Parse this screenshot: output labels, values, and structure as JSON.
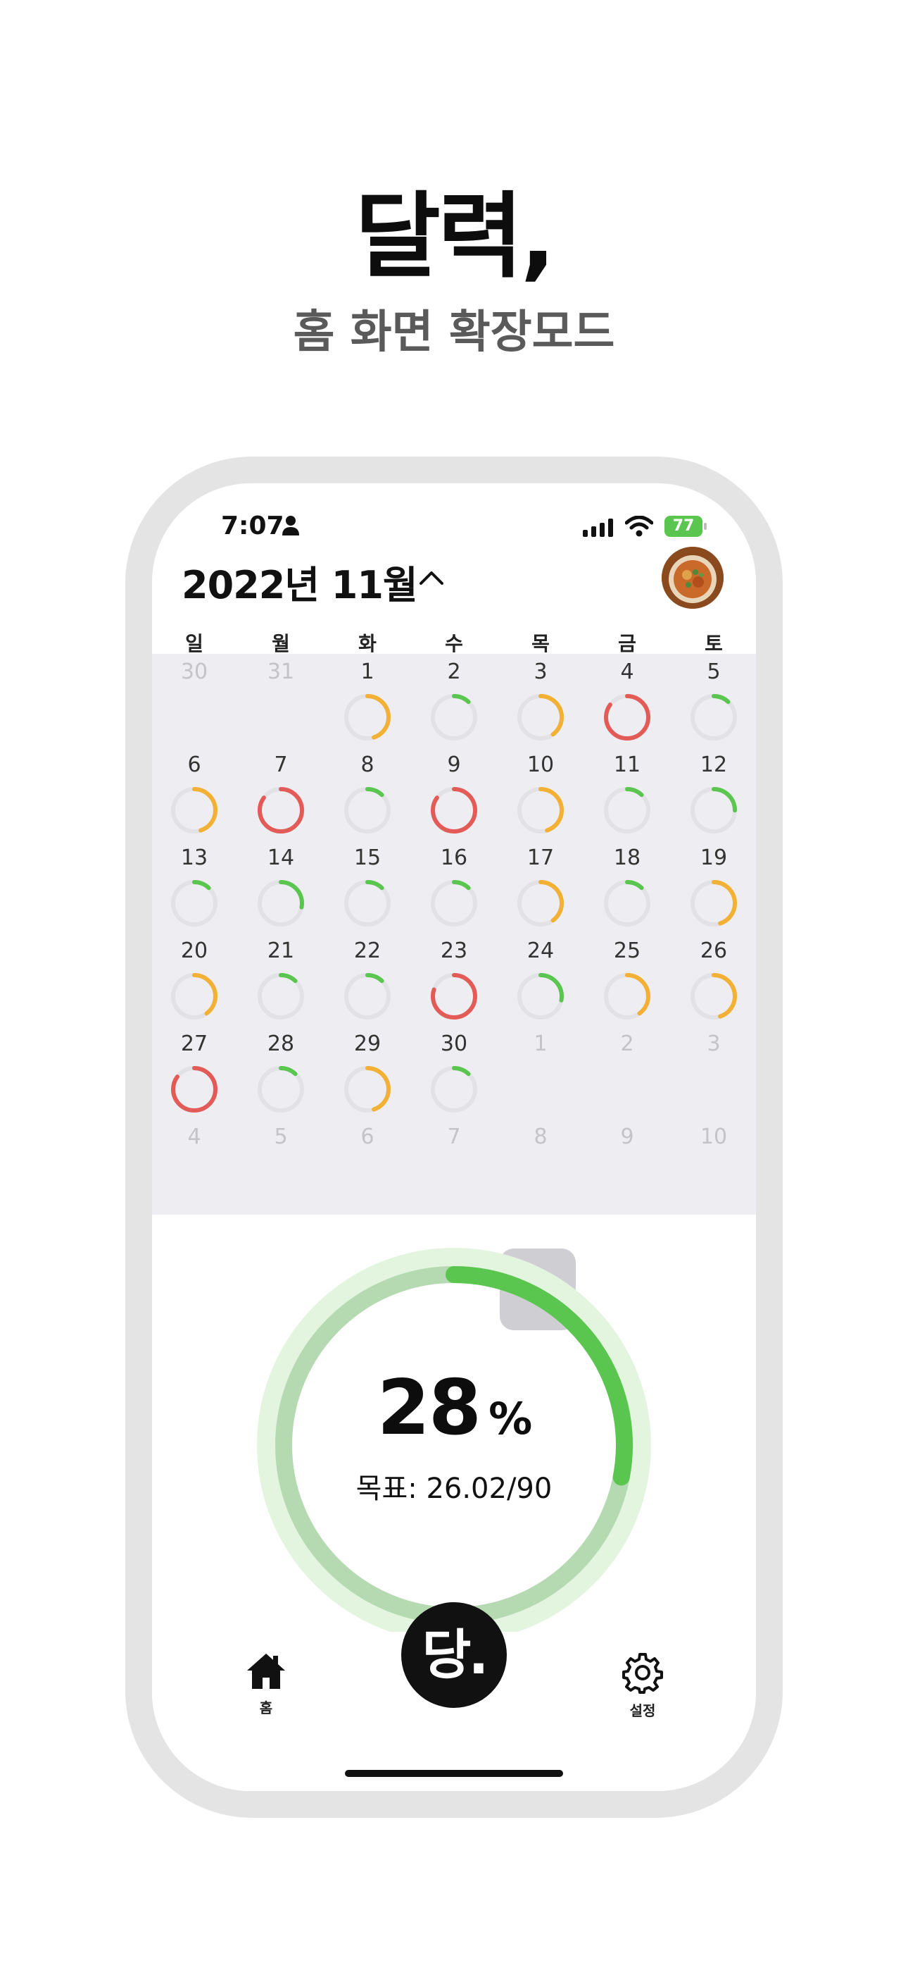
{
  "promo": {
    "title": "달력,",
    "subtitle": "홈 화면 확장모드"
  },
  "status_bar": {
    "time": "7:07",
    "battery": "77"
  },
  "header": {
    "month_title": "2022년 11월"
  },
  "weekdays": [
    "일",
    "월",
    "화",
    "수",
    "목",
    "금",
    "토"
  ],
  "calendar": {
    "today": "24",
    "weeks": [
      [
        {
          "d": "30",
          "m": "prev"
        },
        {
          "d": "31",
          "m": "prev"
        },
        {
          "d": "1",
          "ring": "orange",
          "p": 0.45
        },
        {
          "d": "2",
          "ring": "green",
          "p": 0.12
        },
        {
          "d": "3",
          "ring": "orange",
          "p": 0.4
        },
        {
          "d": "4",
          "ring": "red",
          "p": 0.85
        },
        {
          "d": "5",
          "ring": "green",
          "p": 0.12
        }
      ],
      [
        {
          "d": "6",
          "ring": "orange",
          "p": 0.45
        },
        {
          "d": "7",
          "ring": "red",
          "p": 0.85
        },
        {
          "d": "8",
          "ring": "green",
          "p": 0.12
        },
        {
          "d": "9",
          "ring": "red",
          "p": 0.85
        },
        {
          "d": "10",
          "ring": "orange",
          "p": 0.45
        },
        {
          "d": "11",
          "ring": "green",
          "p": 0.12
        },
        {
          "d": "12",
          "ring": "green",
          "p": 0.25
        }
      ],
      [
        {
          "d": "13",
          "ring": "green",
          "p": 0.12
        },
        {
          "d": "14",
          "ring": "green",
          "p": 0.28
        },
        {
          "d": "15",
          "ring": "green",
          "p": 0.12
        },
        {
          "d": "16",
          "ring": "green",
          "p": 0.12
        },
        {
          "d": "17",
          "ring": "orange",
          "p": 0.4
        },
        {
          "d": "18",
          "ring": "green",
          "p": 0.12
        },
        {
          "d": "19",
          "ring": "orange",
          "p": 0.45
        }
      ],
      [
        {
          "d": "20",
          "ring": "orange",
          "p": 0.4
        },
        {
          "d": "21",
          "ring": "green",
          "p": 0.12
        },
        {
          "d": "22",
          "ring": "green",
          "p": 0.12
        },
        {
          "d": "23",
          "ring": "red",
          "p": 0.8
        },
        {
          "d": "24",
          "ring": "green",
          "p": 0.28
        },
        {
          "d": "25",
          "ring": "orange",
          "p": 0.4
        },
        {
          "d": "26",
          "ring": "orange",
          "p": 0.45
        }
      ],
      [
        {
          "d": "27",
          "ring": "red",
          "p": 0.85
        },
        {
          "d": "28",
          "ring": "green",
          "p": 0.12
        },
        {
          "d": "29",
          "ring": "orange",
          "p": 0.45
        },
        {
          "d": "30",
          "ring": "green",
          "p": 0.12
        },
        {
          "d": "1",
          "m": "next"
        },
        {
          "d": "2",
          "m": "next"
        },
        {
          "d": "3",
          "m": "next"
        }
      ],
      [
        {
          "d": "4",
          "m": "next"
        },
        {
          "d": "5",
          "m": "next"
        },
        {
          "d": "6",
          "m": "next"
        },
        {
          "d": "7",
          "m": "next"
        },
        {
          "d": "8",
          "m": "next"
        },
        {
          "d": "9",
          "m": "next"
        },
        {
          "d": "10",
          "m": "next"
        }
      ]
    ]
  },
  "ring_colors": {
    "green": "#5ac64f",
    "orange": "#f2b035",
    "red": "#e35b57",
    "track": "#e2e2e6"
  },
  "progress": {
    "value": "28",
    "unit": "%",
    "fraction": 0.28,
    "goal_text": "목표: 26.02/90",
    "arc_color": "#5ac64f",
    "track_color": "#b5d9b0",
    "halo_color": "#e3f5df"
  },
  "tab_bar": {
    "home_label": "홈",
    "center_label": "당.",
    "settings_label": "설정"
  }
}
